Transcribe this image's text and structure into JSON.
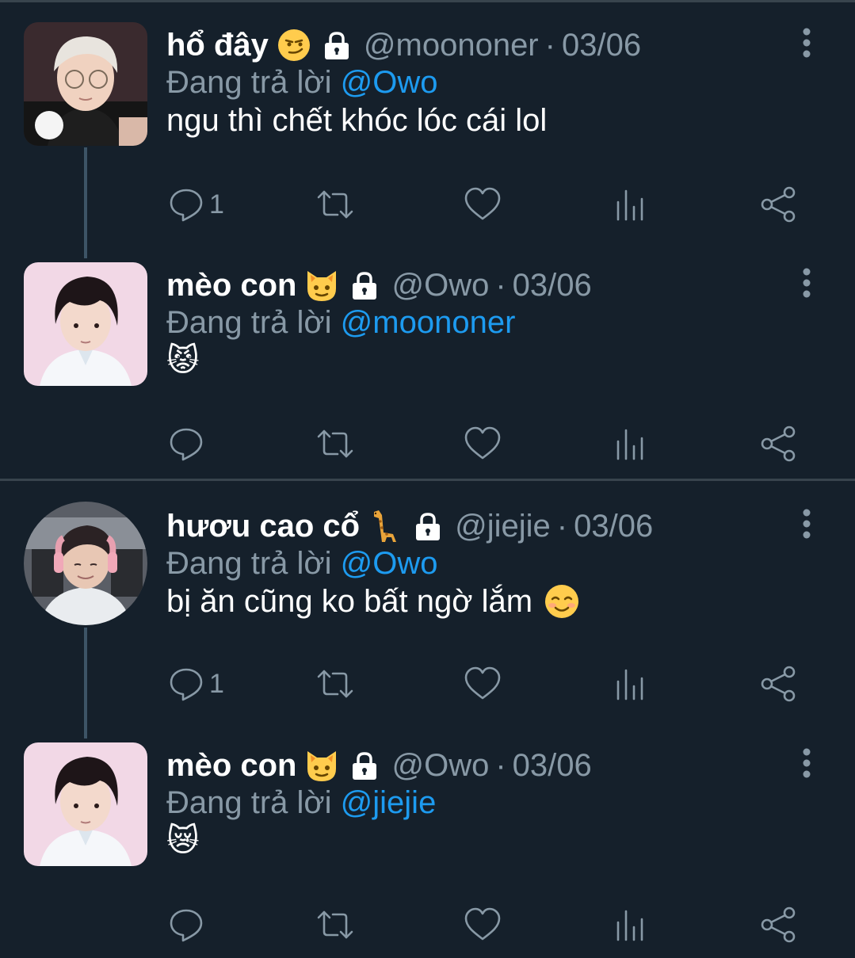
{
  "tweets": [
    {
      "name": "hổ đây",
      "emoji": "smirk-emoji",
      "handle": "@moononer",
      "date": "03/06",
      "reply_prefix": "Đang trả lời",
      "reply_to": "@Owo",
      "text": "ngu thì chết khóc lóc cái lol",
      "reply_count": "1"
    },
    {
      "name": "mèo con",
      "emoji": "cat-face-emoji",
      "handle": "@Owo",
      "date": "03/06",
      "reply_prefix": "Đang trả lời",
      "reply_to": "@moononer",
      "text": "😾",
      "reply_count": ""
    },
    {
      "name": "hươu cao cổ",
      "emoji": "giraffe-emoji",
      "handle": "@jiejie",
      "date": "03/06",
      "reply_prefix": "Đang trả lời",
      "reply_to": "@Owo",
      "text": "bị ăn cũng ko bất ngờ lắm",
      "reply_count": "1"
    },
    {
      "name": "mèo con",
      "emoji": "cat-face-emoji",
      "handle": "@Owo",
      "date": "03/06",
      "reply_prefix": "Đang trả lời",
      "reply_to": "@jiejie",
      "text": "😿",
      "reply_count": ""
    }
  ],
  "separator": "·",
  "icons": [
    "reply-icon",
    "retweet-icon",
    "like-icon",
    "analytics-icon",
    "share-icon",
    "more-icon",
    "lock-icon"
  ],
  "colors": {
    "background": "#15202b",
    "muted": "#8899a6",
    "accent": "#1d9bf0",
    "divider": "#38444d"
  }
}
